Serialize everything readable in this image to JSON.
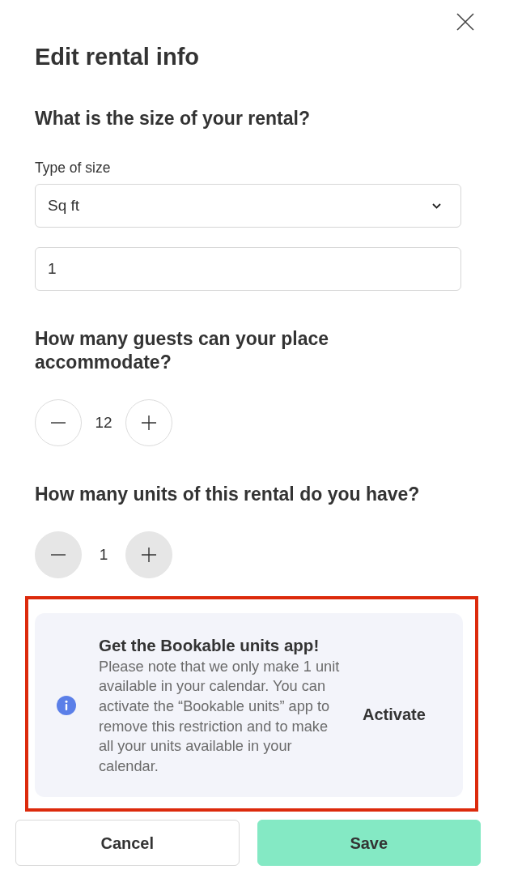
{
  "dialog": {
    "title": "Edit rental info"
  },
  "sections": [
    {
      "kind": "size",
      "question": "What is the size of your rental?",
      "label": "Type of size",
      "select_value": "Sq ft",
      "input_value": "1"
    },
    {
      "kind": "counter",
      "question": "How many guests can your place accommodate?",
      "value": "12",
      "disabled": false
    },
    {
      "kind": "counter",
      "question": "How many units of this rental do you have?",
      "value": "1",
      "disabled": true
    }
  ],
  "notice": {
    "title": "Get the Bookable units app!",
    "text": "Please note that we only make 1 unit available in your calendar. You can activate the “Bookable units” app to remove this restriction and to make all your units available in your calendar.",
    "action": "Activate",
    "highlighted": true
  },
  "buttons": [
    {
      "label": "Cancel",
      "kind": "secondary"
    },
    {
      "label": "Save",
      "kind": "primary"
    }
  ]
}
